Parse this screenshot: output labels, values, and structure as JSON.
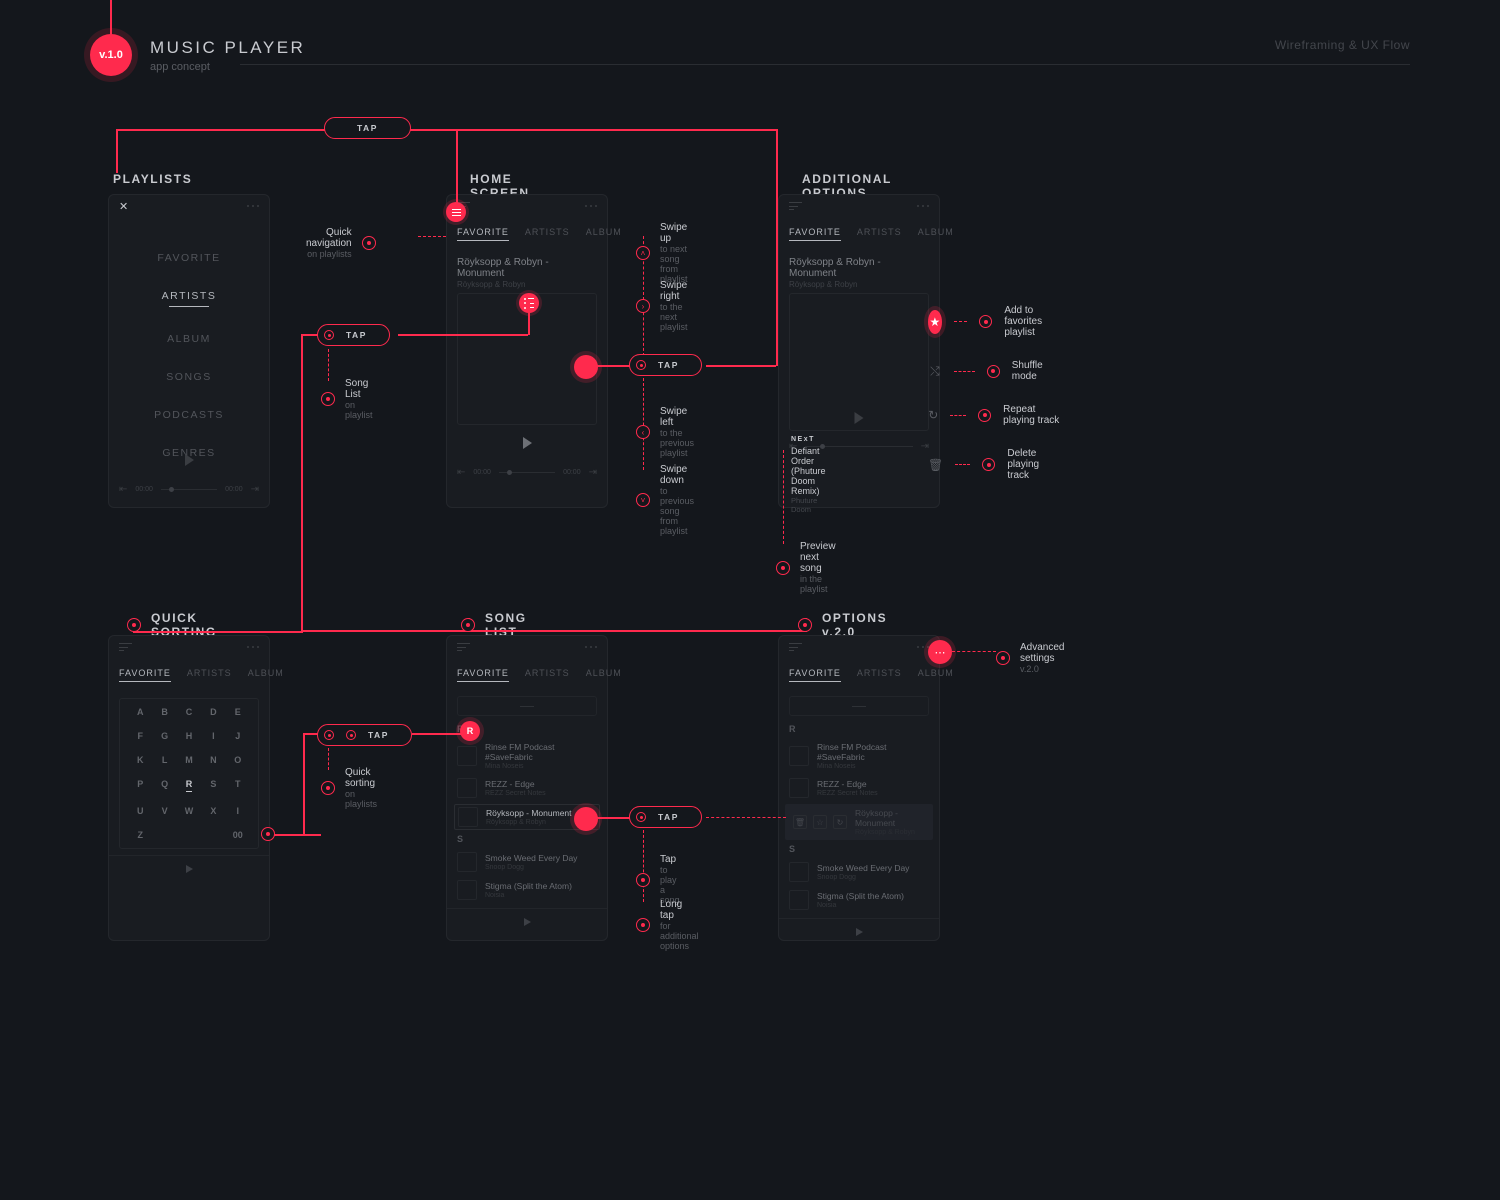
{
  "header": {
    "version": "v.1.0",
    "title": "MUSIC PLAYER",
    "subtitle": "app concept",
    "right": "Wireframing & UX Flow"
  },
  "sections": {
    "playlists": "PLAYLISTS",
    "home": "HOME SCREEN",
    "additional": "ADDITIONAL OPTIONS",
    "sorting": "QUICK SORTING",
    "songlist": "SONG LIST",
    "options2": "OPTIONS v.2.0"
  },
  "tabs": {
    "favorite": "FAVORITE",
    "artists": "ARTISTS",
    "album": "ALBUM"
  },
  "pills": {
    "tap": "TAP"
  },
  "playlists_menu": [
    "FAVORITE",
    "ARTISTS",
    "ALBUM",
    "SONGS",
    "PODCASTS",
    "GENRES"
  ],
  "home": {
    "track_title": "Röyksopp & Robyn - Monument",
    "track_sub": "Röyksopp & Robyn",
    "time_l": "00:00",
    "time_r": "00:00"
  },
  "additional": {
    "track_title": "Röyksopp & Robyn - Monument",
    "track_sub": "Röyksopp & Robyn",
    "actions": {
      "fav": "Add to favorites playlist",
      "shuffle": "Shuffle mode",
      "repeat": "Repeat playing track",
      "delete": "Delete playing track"
    },
    "next_lbl": "NExT",
    "next_title": "Defiant Order (Phuture Doom Remix)",
    "next_sub": "Phuture Doom",
    "preview_l1": "Preview next song",
    "preview_l2": "in the playlist"
  },
  "annots": {
    "quick_nav_l1": "Quick navigation",
    "quick_nav_l2": "on playlists",
    "song_list_l1": "Song List",
    "song_list_l2": "on playlist",
    "swipe_up_l1": "Swipe up",
    "swipe_up_l2": "to next song",
    "swipe_up_l3": "from playlist",
    "swipe_right_l1": "Swipe right",
    "swipe_right_l2": "to the next",
    "swipe_right_l3": "playlist",
    "swipe_left_l1": "Swipe left",
    "swipe_left_l2": "to the previous",
    "swipe_left_l3": "playlist",
    "swipe_down_l1": "Swipe down",
    "swipe_down_l2": "to previous song",
    "swipe_down_l3": "from playlist",
    "quick_sort_l1": "Quick sorting",
    "quick_sort_l2": "on playlists",
    "tap_l1": "Tap",
    "tap_l2": "to play a song",
    "longtap_l1": "Long tap",
    "longtap_l2": "for additional",
    "longtap_l3": "options",
    "advset_l1": "Advanced settings",
    "advset_l2": "v.2.0"
  },
  "alpha": [
    "A",
    "B",
    "C",
    "D",
    "E",
    "F",
    "G",
    "H",
    "I",
    "J",
    "K",
    "L",
    "M",
    "N",
    "O",
    "P",
    "Q",
    "R",
    "S",
    "T",
    "U",
    "V",
    "W",
    "X",
    "I",
    "Z",
    "",
    "",
    "",
    "00"
  ],
  "alpha_active": "R",
  "songs": {
    "rHead": "R",
    "sHead": "S",
    "r": [
      {
        "t": "Rinse FM Podcast #SaveFabric",
        "s": "Mina Noseis"
      },
      {
        "t": "REZZ - Edge",
        "s": "REZZ Secret Notes"
      },
      {
        "t": "Röyksopp - Monument",
        "s": "Röyksopp & Robyn"
      }
    ],
    "s": [
      {
        "t": "Smoke Weed Every Day",
        "s": "Snoop Dogg"
      },
      {
        "t": "Stigma (Split the Atom)",
        "s": "Noisia"
      }
    ]
  }
}
